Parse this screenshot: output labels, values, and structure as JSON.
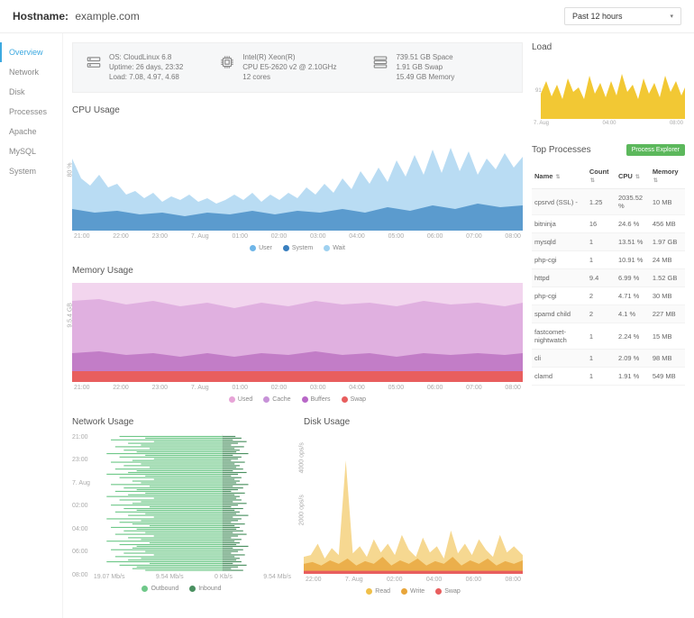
{
  "header": {
    "hostname_label": "Hostname:",
    "hostname_value": "example.com",
    "time_range": "Past 12 hours"
  },
  "sidebar": {
    "items": [
      "Overview",
      "Network",
      "Disk",
      "Processes",
      "Apache",
      "MySQL",
      "System"
    ],
    "active": 0
  },
  "infobar": {
    "os": {
      "os_line": "OS: CloudLinux 6.8",
      "uptime_line": "Uptime: 26 days, 23:32",
      "load_line": "Load: 7.08, 4.97, 4.68"
    },
    "cpu": {
      "cpu_name": "Intel(R) Xeon(R)",
      "cpu_model": "CPU E5-2620 v2 @ 2.10GHz",
      "cores": "12 cores"
    },
    "storage": {
      "space": "739.51 GB Space",
      "swap": "1.91 GB Swap",
      "memory": "15.49 GB Memory"
    }
  },
  "cpu_usage": {
    "title": "CPU Usage",
    "ylabel": "80 %",
    "xticks": [
      "21:00",
      "22:00",
      "23:00",
      "7. Aug",
      "01:00",
      "02:00",
      "03:00",
      "04:00",
      "05:00",
      "06:00",
      "07:00",
      "08:00"
    ],
    "legend": [
      "User",
      "System",
      "Wait"
    ],
    "colors": [
      "#6fb6e8",
      "#3a7fbf",
      "#9fd1f0"
    ]
  },
  "memory_usage": {
    "title": "Memory Usage",
    "ylabel": "9.5.4 GB",
    "xticks": [
      "21:00",
      "22:00",
      "23:00",
      "7. Aug",
      "01:00",
      "02:00",
      "03:00",
      "04:00",
      "05:00",
      "06:00",
      "07:00",
      "08:00"
    ],
    "legend": [
      "Used",
      "Cache",
      "Buffers",
      "Swap"
    ],
    "colors": [
      "#e7a4d7",
      "#c792d8",
      "#b867c7",
      "#e85e5e"
    ]
  },
  "network_usage": {
    "title": "Network Usage",
    "yticks": [
      "08:00",
      "06:00",
      "04:00",
      "02:00",
      "7. Aug",
      "23:00",
      "21:00"
    ],
    "xticks": [
      "19.07 Mb/s",
      "9.54 Mb/s",
      "0 Kb/s",
      "9.54 Mb/s"
    ],
    "legend": [
      "Outbound",
      "Inbound"
    ],
    "colors": [
      "#6fc889",
      "#4a9060"
    ]
  },
  "disk_usage": {
    "title": "Disk Usage",
    "yticks": [
      "4000 ops/s",
      "2000 ops/s"
    ],
    "xticks": [
      "22:00",
      "7. Aug",
      "02:00",
      "04:00",
      "06:00",
      "08:00"
    ],
    "legend": [
      "Read",
      "Write",
      "Swap"
    ],
    "colors": [
      "#f0c04a",
      "#e8a53a",
      "#e85e5e"
    ]
  },
  "load": {
    "title": "Load",
    "xticks": [
      "7. Aug",
      "04:00",
      "08:00"
    ],
    "ylabel": "91"
  },
  "top_processes": {
    "title": "Top Processes",
    "button": "Process Explorer",
    "columns": [
      "Name",
      "Count",
      "CPU",
      "Memory"
    ],
    "rows": [
      {
        "name": "cpsrvd (SSL) -",
        "count": "1.25",
        "cpu": "2035.52 %",
        "mem": "10 MB"
      },
      {
        "name": "bitninja",
        "count": "16",
        "cpu": "24.6 %",
        "mem": "456 MB"
      },
      {
        "name": "mysqld",
        "count": "1",
        "cpu": "13.51 %",
        "mem": "1.97 GB"
      },
      {
        "name": "php-cgi",
        "count": "1",
        "cpu": "10.91 %",
        "mem": "24 MB"
      },
      {
        "name": "httpd",
        "count": "9.4",
        "cpu": "6.99 %",
        "mem": "1.52 GB"
      },
      {
        "name": "php-cgi",
        "count": "2",
        "cpu": "4.71 %",
        "mem": "30 MB"
      },
      {
        "name": "spamd child",
        "count": "2",
        "cpu": "4.1 %",
        "mem": "227 MB"
      },
      {
        "name": "fastcomet-nightwatch",
        "count": "1",
        "cpu": "2.24 %",
        "mem": "15 MB"
      },
      {
        "name": "cli",
        "count": "1",
        "cpu": "2.09 %",
        "mem": "98 MB"
      },
      {
        "name": "clamd",
        "count": "1",
        "cpu": "1.91 %",
        "mem": "549 MB"
      }
    ]
  },
  "chart_data": [
    {
      "type": "area",
      "title": "CPU Usage",
      "ylabel": "%",
      "ylim": [
        0,
        80
      ],
      "categories": [
        "21:00",
        "22:00",
        "23:00",
        "7. Aug",
        "01:00",
        "02:00",
        "03:00",
        "04:00",
        "05:00",
        "06:00",
        "07:00",
        "08:00"
      ],
      "series": [
        {
          "name": "User",
          "values": [
            48,
            35,
            30,
            28,
            25,
            28,
            25,
            30,
            38,
            45,
            55,
            50
          ]
        },
        {
          "name": "System",
          "values": [
            12,
            10,
            8,
            8,
            7,
            8,
            7,
            9,
            10,
            12,
            14,
            13
          ]
        },
        {
          "name": "Wait",
          "values": [
            3,
            2,
            2,
            2,
            2,
            2,
            2,
            3,
            3,
            4,
            4,
            3
          ]
        }
      ]
    },
    {
      "type": "area",
      "title": "Memory Usage",
      "ylabel": "GB",
      "ylim": [
        0,
        15.49
      ],
      "categories": [
        "21:00",
        "22:00",
        "23:00",
        "7. Aug",
        "01:00",
        "02:00",
        "03:00",
        "04:00",
        "05:00",
        "06:00",
        "07:00",
        "08:00"
      ],
      "series": [
        {
          "name": "Used",
          "values": [
            11.5,
            11.3,
            11.0,
            11.1,
            11.2,
            11.0,
            11.4,
            11.3,
            11.6,
            11.5,
            11.4,
            11.6
          ]
        },
        {
          "name": "Cache",
          "values": [
            2.0,
            2.1,
            2.2,
            2.1,
            2.0,
            2.2,
            2.1,
            2.0,
            2.1,
            2.1,
            2.2,
            2.0
          ]
        },
        {
          "name": "Buffers",
          "values": [
            0.5,
            0.5,
            0.5,
            0.5,
            0.5,
            0.5,
            0.5,
            0.5,
            0.5,
            0.5,
            0.5,
            0.5
          ]
        },
        {
          "name": "Swap",
          "values": [
            1.5,
            1.5,
            1.5,
            1.5,
            1.5,
            1.5,
            1.5,
            1.5,
            1.5,
            1.5,
            1.5,
            1.5
          ]
        }
      ]
    },
    {
      "type": "bar",
      "title": "Network Usage",
      "xlabel": "Mb/s",
      "categories": [
        "21:00",
        "23:00",
        "7. Aug",
        "02:00",
        "04:00",
        "06:00",
        "08:00"
      ],
      "series": [
        {
          "name": "Outbound",
          "values": [
            -8,
            -14,
            -6,
            -10,
            -9,
            -12,
            -7
          ]
        },
        {
          "name": "Inbound",
          "values": [
            3,
            4,
            2,
            3,
            3,
            4,
            2
          ]
        }
      ]
    },
    {
      "type": "area",
      "title": "Disk Usage",
      "ylabel": "ops/s",
      "ylim": [
        0,
        5000
      ],
      "categories": [
        "22:00",
        "7. Aug",
        "02:00",
        "04:00",
        "06:00",
        "08:00"
      ],
      "series": [
        {
          "name": "Read",
          "values": [
            600,
            500,
            800,
            700,
            900,
            750
          ]
        },
        {
          "name": "Write",
          "values": [
            400,
            350,
            600,
            500,
            650,
            500
          ]
        },
        {
          "name": "Swap",
          "values": [
            50,
            50,
            50,
            50,
            50,
            50
          ]
        }
      ]
    },
    {
      "type": "area",
      "title": "Load",
      "ylim": [
        0,
        10
      ],
      "categories": [
        "7. Aug",
        "04:00",
        "08:00"
      ],
      "series": [
        {
          "name": "load",
          "values": [
            5,
            6,
            7
          ]
        }
      ]
    }
  ]
}
